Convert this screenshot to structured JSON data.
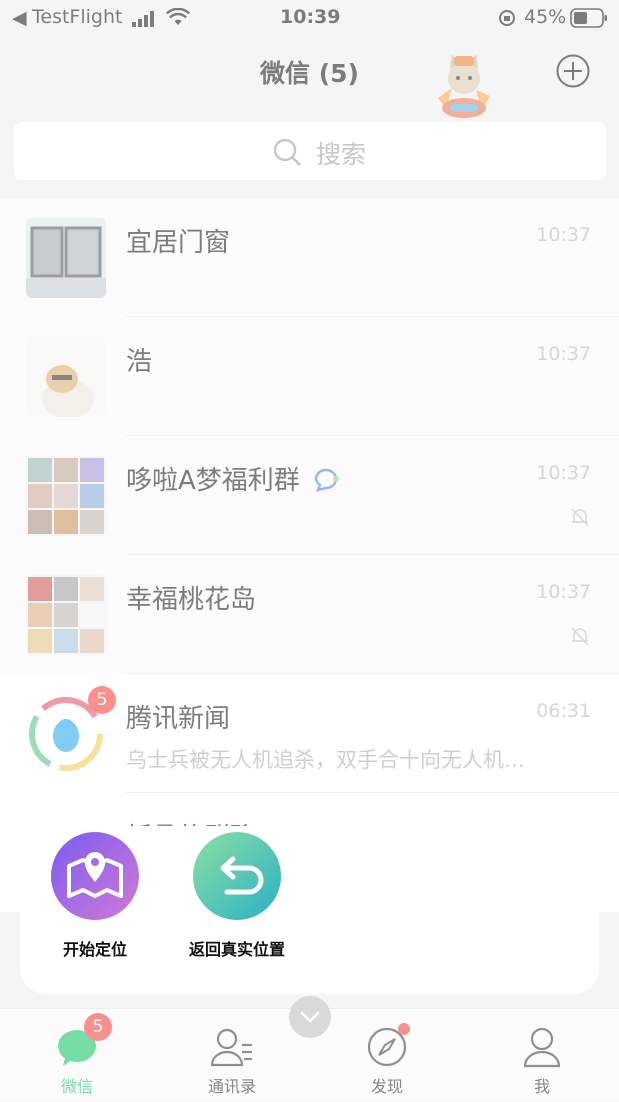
{
  "status_bar": {
    "back_glyph": "◀",
    "carrier": "TestFlight",
    "time": "10:39",
    "battery": "45%"
  },
  "header": {
    "title": "微信 (5)",
    "add_icon": "plus-circle-icon"
  },
  "search": {
    "placeholder": "搜索"
  },
  "chats": [
    {
      "name": "宜居门窗",
      "time": "10:37",
      "message": "",
      "muted": false
    },
    {
      "name": "浩",
      "time": "10:37",
      "message": "",
      "muted": false
    },
    {
      "name": "哆啦A梦福利群",
      "time": "10:37",
      "message": "",
      "muted": true
    },
    {
      "name": "幸福桃花岛",
      "time": "10:37",
      "message": "",
      "muted": true
    },
    {
      "name": "腾讯新闻",
      "time": "06:31",
      "message": "乌士兵被无人机追杀，双手合十向无人机…",
      "badge": "5"
    },
    {
      "name": "折叠的群聊",
      "time": "",
      "message": ""
    }
  ],
  "popup": {
    "actions": [
      {
        "label": "开始定位",
        "icon": "map-pin-icon"
      },
      {
        "label": "返回真实位置",
        "icon": "return-arrow-icon"
      }
    ]
  },
  "tabbar": {
    "tabs": [
      {
        "label": "微信",
        "badge": "5",
        "active": true
      },
      {
        "label": "通讯录"
      },
      {
        "label": "发现",
        "dot": true
      },
      {
        "label": "我"
      }
    ]
  },
  "colors": {
    "accent": "#07c160",
    "badge": "#f43530",
    "popup_icon1": "#9b5cf0",
    "popup_icon2": "#3fc7a4"
  }
}
